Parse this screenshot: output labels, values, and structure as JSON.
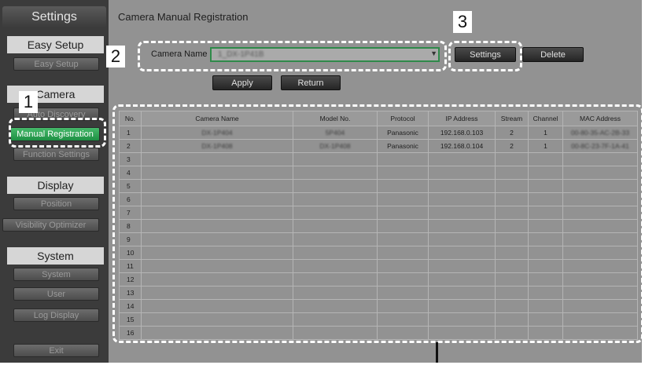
{
  "sidebar": {
    "title": "Settings",
    "sections": {
      "easy_setup": {
        "label": "Easy Setup",
        "items": [
          "Easy Setup"
        ]
      },
      "camera": {
        "label": "Camera",
        "items": [
          "Auto Discovery",
          "Manual Registration",
          "Function Settings"
        ]
      },
      "display": {
        "label": "Display",
        "items": [
          "Position",
          "Visibility Optimizer"
        ]
      },
      "system": {
        "label": "System",
        "items": [
          "System",
          "User",
          "Log Display"
        ]
      }
    },
    "exit_label": "Exit"
  },
  "main": {
    "title": "Camera Manual Registration",
    "camera_name_label": "Camera Name",
    "camera_name_value": "1_DX-1P41B",
    "settings_button": "Settings",
    "delete_button": "Delete",
    "apply_button": "Apply",
    "return_button": "Return"
  },
  "callouts": [
    "1",
    "2",
    "3"
  ],
  "table": {
    "columns": [
      "No.",
      "Camera Name",
      "Model No.",
      "Protocol",
      "IP Address",
      "Stream",
      "Channel",
      "MAC Address"
    ],
    "rows": [
      [
        "1",
        "DX-1P404",
        "5P404",
        "Panasonic",
        "192.168.0.103",
        "2",
        "1",
        "00-80-35-AC-2B-33"
      ],
      [
        "2",
        "DX-1P408",
        "DX-1P408",
        "Panasonic",
        "192.168.0.104",
        "2",
        "1",
        "00-8C-23-7F-1A-41"
      ],
      [
        "3",
        "",
        "",
        "",
        "",
        "",
        "",
        ""
      ],
      [
        "4",
        "",
        "",
        "",
        "",
        "",
        "",
        ""
      ],
      [
        "5",
        "",
        "",
        "",
        "",
        "",
        "",
        ""
      ],
      [
        "6",
        "",
        "",
        "",
        "",
        "",
        "",
        ""
      ],
      [
        "7",
        "",
        "",
        "",
        "",
        "",
        "",
        ""
      ],
      [
        "8",
        "",
        "",
        "",
        "",
        "",
        "",
        ""
      ],
      [
        "9",
        "",
        "",
        "",
        "",
        "",
        "",
        ""
      ],
      [
        "10",
        "",
        "",
        "",
        "",
        "",
        "",
        ""
      ],
      [
        "11",
        "",
        "",
        "",
        "",
        "",
        "",
        ""
      ],
      [
        "12",
        "",
        "",
        "",
        "",
        "",
        "",
        ""
      ],
      [
        "13",
        "",
        "",
        "",
        "",
        "",
        "",
        ""
      ],
      [
        "14",
        "",
        "",
        "",
        "",
        "",
        "",
        ""
      ],
      [
        "15",
        "",
        "",
        "",
        "",
        "",
        "",
        ""
      ],
      [
        "16",
        "",
        "",
        "",
        "",
        "",
        "",
        ""
      ]
    ]
  },
  "colors": {
    "active_green": "#2da653",
    "callout_border": "#ffffff",
    "background": "#929292"
  }
}
